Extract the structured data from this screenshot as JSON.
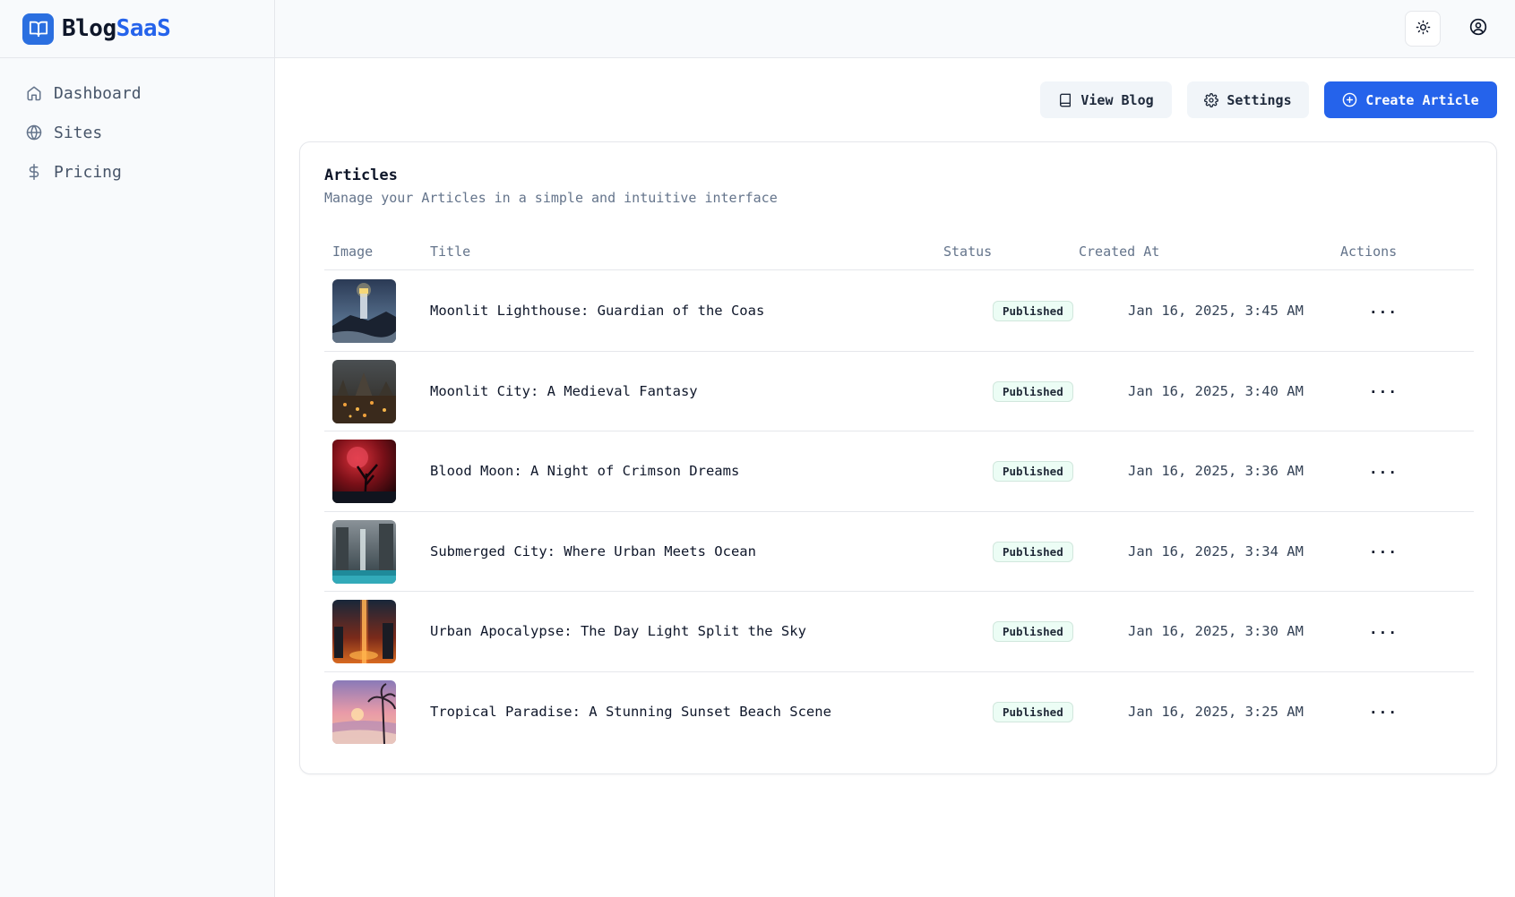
{
  "brand": {
    "name_part1": "Blog",
    "name_part2": "SaaS",
    "logo_icon": "book-open-icon",
    "accent": "#2563eb"
  },
  "sidebar": {
    "items": [
      {
        "label": "Dashboard",
        "icon": "home-icon"
      },
      {
        "label": "Sites",
        "icon": "globe-icon"
      },
      {
        "label": "Pricing",
        "icon": "dollar-icon"
      }
    ]
  },
  "header": {
    "theme_icon": "sun-icon",
    "user_icon": "user-circle-icon"
  },
  "actions": {
    "view_blog": "View Blog",
    "settings": "Settings",
    "create_article": "Create Article"
  },
  "articles": {
    "title": "Articles",
    "subtitle": "Manage your Articles in a simple and intuitive interface",
    "columns": {
      "image": "Image",
      "title": "Title",
      "status": "Status",
      "created_at": "Created At",
      "actions": "Actions"
    },
    "rows": [
      {
        "title": "Moonlit Lighthouse: Guardian of the Coas",
        "status": "Published",
        "created_at": "Jan 16, 2025, 3:45 AM",
        "thumb": "lighthouse"
      },
      {
        "title": "Moonlit City: A Medieval Fantasy",
        "status": "Published",
        "created_at": "Jan 16, 2025, 3:40 AM",
        "thumb": "city"
      },
      {
        "title": "Blood Moon: A Night of Crimson Dreams",
        "status": "Published",
        "created_at": "Jan 16, 2025, 3:36 AM",
        "thumb": "bloodmoon"
      },
      {
        "title": "Submerged City: Where Urban Meets Ocean",
        "status": "Published",
        "created_at": "Jan 16, 2025, 3:34 AM",
        "thumb": "submerged"
      },
      {
        "title": "Urban Apocalypse: The Day Light Split the Sky",
        "status": "Published",
        "created_at": "Jan 16, 2025, 3:30 AM",
        "thumb": "apocalypse"
      },
      {
        "title": "Tropical Paradise: A Stunning Sunset Beach Scene",
        "status": "Published",
        "created_at": "Jan 16, 2025, 3:25 AM",
        "thumb": "tropical"
      }
    ],
    "row_action": "···"
  }
}
